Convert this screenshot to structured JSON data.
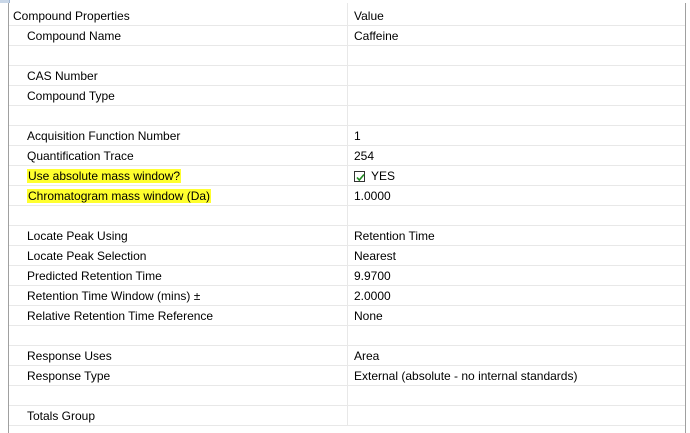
{
  "header": {
    "property_label": "Compound Properties",
    "value_label": "Value"
  },
  "rows": [
    {
      "name": "Compound Name",
      "value": "Caffeine"
    },
    {
      "name": "",
      "value": ""
    },
    {
      "name": "CAS Number",
      "value": ""
    },
    {
      "name": "Compound Type",
      "value": ""
    },
    {
      "name": "",
      "value": ""
    },
    {
      "name": "Acquisition Function Number",
      "value": "1"
    },
    {
      "name": "Quantification Trace",
      "value": "254"
    },
    {
      "name": "Use absolute mass window?",
      "value": "YES",
      "checked": true
    },
    {
      "name": "Chromatogram mass window (Da)",
      "value": "1.0000"
    },
    {
      "name": "",
      "value": ""
    },
    {
      "name": "Locate Peak Using",
      "value": "Retention Time"
    },
    {
      "name": "Locate Peak Selection",
      "value": "Nearest"
    },
    {
      "name": "Predicted Retention Time",
      "value": "9.9700"
    },
    {
      "name": "Retention Time Window (mins) ±",
      "value": "2.0000"
    },
    {
      "name": "Relative Retention Time Reference",
      "value": "None"
    },
    {
      "name": "",
      "value": ""
    },
    {
      "name": "Response Uses",
      "value": "Area"
    },
    {
      "name": "Response Type",
      "value": "External (absolute - no internal standards)"
    },
    {
      "name": "",
      "value": ""
    },
    {
      "name": "Totals Group",
      "value": ""
    }
  ],
  "colors": {
    "highlight": "#ffff2e",
    "grid_line": "#e8e8e8"
  },
  "icons": {
    "checkbox": "check-icon"
  }
}
